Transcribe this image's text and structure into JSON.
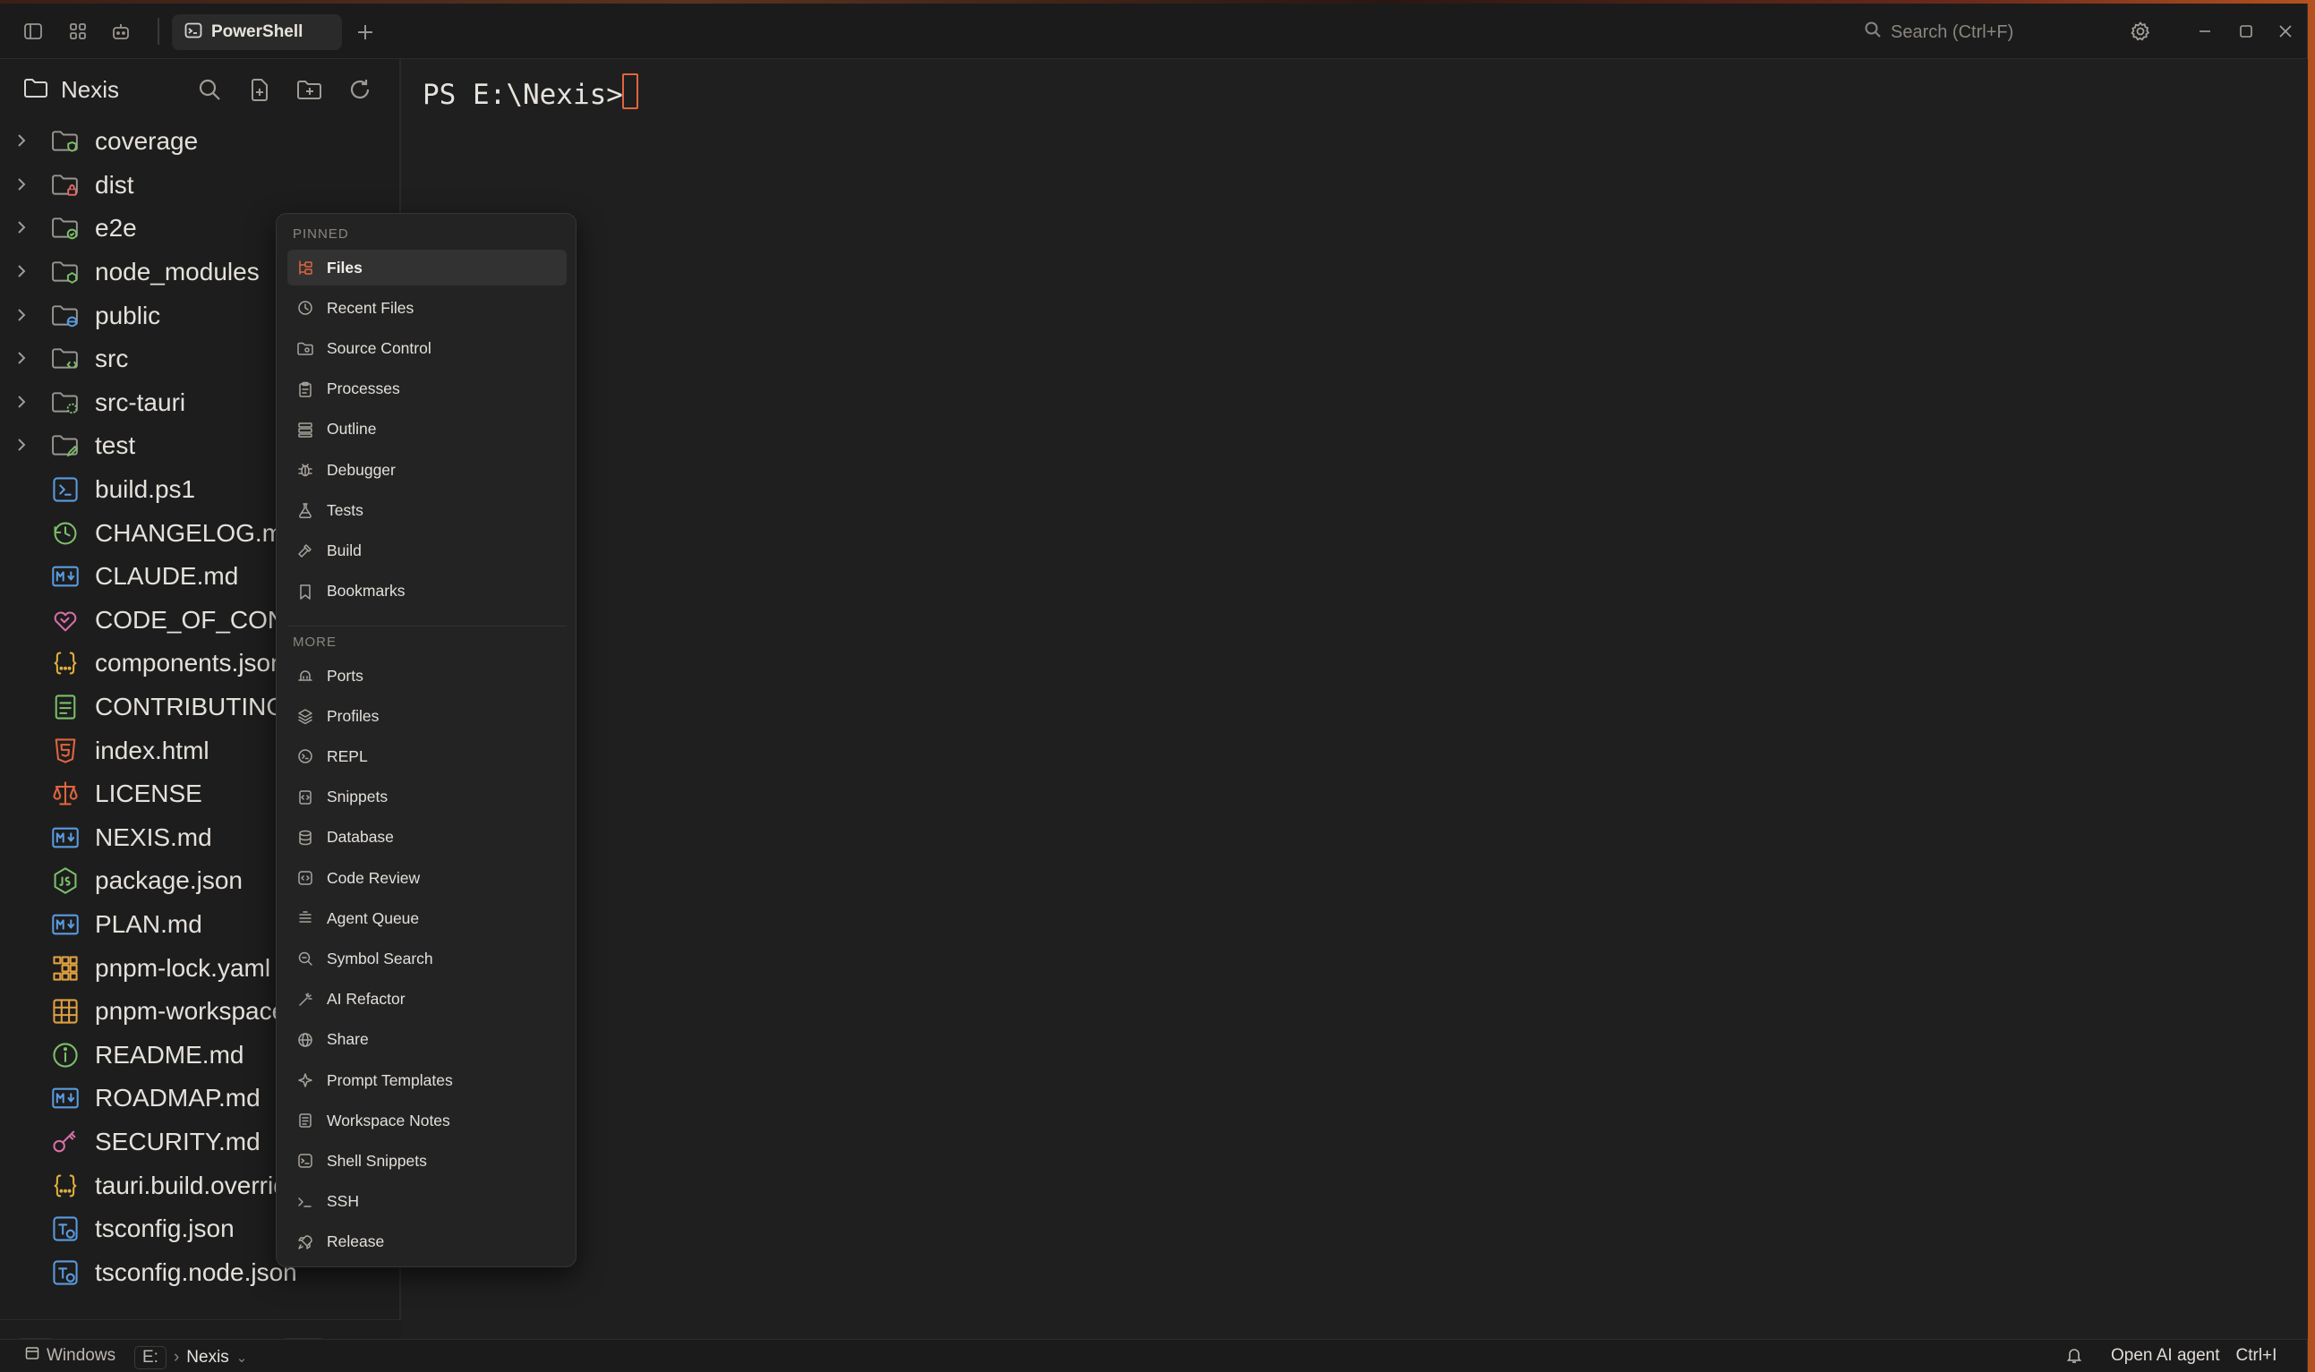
{
  "titlebar": {
    "tab_label": "PowerShell",
    "search_placeholder": "Search (Ctrl+F)"
  },
  "sidebar": {
    "folder_name": "Nexis",
    "items": [
      {
        "label": "coverage",
        "type": "folder",
        "icon": "folder-shield-icon",
        "color": "#7bbf6a"
      },
      {
        "label": "dist",
        "type": "folder",
        "icon": "folder-lock-icon",
        "color": "#e06b6b"
      },
      {
        "label": "e2e",
        "type": "folder",
        "icon": "folder-check-icon",
        "color": "#7bbf6a"
      },
      {
        "label": "node_modules",
        "type": "folder",
        "icon": "folder-node-icon",
        "color": "#7bbf6a"
      },
      {
        "label": "public",
        "type": "folder",
        "icon": "folder-globe-icon",
        "color": "#5a9be0"
      },
      {
        "label": "src",
        "type": "folder",
        "icon": "folder-code-icon",
        "color": "#7bbf6a"
      },
      {
        "label": "src-tauri",
        "type": "folder",
        "icon": "folder-gear-icon",
        "color": "#7bbf6a"
      },
      {
        "label": "test",
        "type": "folder",
        "icon": "folder-pen-icon",
        "color": "#7bbf6a"
      },
      {
        "label": "build.ps1",
        "type": "file",
        "icon": "powershell-file-icon",
        "color": "#5a9be0"
      },
      {
        "label": "CHANGELOG.md",
        "type": "file",
        "icon": "history-file-icon",
        "color": "#7bbf6a"
      },
      {
        "label": "CLAUDE.md",
        "type": "file",
        "icon": "markdown-file-icon",
        "color": "#5a9be0"
      },
      {
        "label": "CODE_OF_CONDUCT.md",
        "type": "file",
        "icon": "heart-handshake-icon",
        "color": "#d86fa8"
      },
      {
        "label": "components.json",
        "type": "file",
        "icon": "json-file-icon",
        "color": "#e0b040"
      },
      {
        "label": "CONTRIBUTING.md",
        "type": "file",
        "icon": "document-file-icon",
        "color": "#7bbf6a"
      },
      {
        "label": "index.html",
        "type": "file",
        "icon": "html-file-icon",
        "color": "#e0653f"
      },
      {
        "label": "LICENSE",
        "type": "file",
        "icon": "scale-icon",
        "color": "#e0653f"
      },
      {
        "label": "NEXIS.md",
        "type": "file",
        "icon": "markdown-file-icon",
        "color": "#5a9be0"
      },
      {
        "label": "package.json",
        "type": "file",
        "icon": "nodejs-file-icon",
        "color": "#7bbf6a"
      },
      {
        "label": "PLAN.md",
        "type": "file",
        "icon": "markdown-file-icon",
        "color": "#5a9be0"
      },
      {
        "label": "pnpm-lock.yaml",
        "type": "file",
        "icon": "pnpm-lock-icon",
        "color": "#e0a040"
      },
      {
        "label": "pnpm-workspace.yaml",
        "type": "file",
        "icon": "pnpm-grid-icon",
        "color": "#e0a040"
      },
      {
        "label": "README.md",
        "type": "file",
        "icon": "info-file-icon",
        "color": "#7bbf6a"
      },
      {
        "label": "ROADMAP.md",
        "type": "file",
        "icon": "markdown-file-icon",
        "color": "#5a9be0"
      },
      {
        "label": "SECURITY.md",
        "type": "file",
        "icon": "key-file-icon",
        "color": "#d86fa8"
      },
      {
        "label": "tauri.build.override.json",
        "type": "file",
        "icon": "json-file-icon",
        "color": "#e0b040"
      },
      {
        "label": "tsconfig.json",
        "type": "file",
        "icon": "typescript-config-icon",
        "color": "#5a9be0"
      },
      {
        "label": "tsconfig.node.json",
        "type": "file",
        "icon": "typescript-config-icon",
        "color": "#5a9be0"
      }
    ]
  },
  "terminal": {
    "prompt": "PS E:\\Nexis> "
  },
  "popup": {
    "pinned_header": "PINNED",
    "more_header": "MORE",
    "pinned": [
      {
        "label": "Files",
        "icon": "tree-icon",
        "selected": true
      },
      {
        "label": "Recent Files",
        "icon": "clock-icon"
      },
      {
        "label": "Source Control",
        "icon": "source-control-icon"
      },
      {
        "label": "Processes",
        "icon": "clipboard-icon"
      },
      {
        "label": "Outline",
        "icon": "outline-icon"
      },
      {
        "label": "Debugger",
        "icon": "bug-icon"
      },
      {
        "label": "Tests",
        "icon": "flask-icon"
      },
      {
        "label": "Build",
        "icon": "hammer-icon"
      },
      {
        "label": "Bookmarks",
        "icon": "bookmark-icon"
      }
    ],
    "more": [
      {
        "label": "Ports",
        "icon": "ports-icon"
      },
      {
        "label": "Profiles",
        "icon": "layers-icon"
      },
      {
        "label": "REPL",
        "icon": "repl-icon"
      },
      {
        "label": "Snippets",
        "icon": "snippet-icon"
      },
      {
        "label": "Database",
        "icon": "database-icon"
      },
      {
        "label": "Code Review",
        "icon": "code-review-icon"
      },
      {
        "label": "Agent Queue",
        "icon": "queue-icon"
      },
      {
        "label": "Symbol Search",
        "icon": "symbol-search-icon"
      },
      {
        "label": "AI Refactor",
        "icon": "wand-icon"
      },
      {
        "label": "Share",
        "icon": "globe-icon"
      },
      {
        "label": "Prompt Templates",
        "icon": "sparkle-icon"
      },
      {
        "label": "Workspace Notes",
        "icon": "note-icon"
      },
      {
        "label": "Shell Snippets",
        "icon": "shell-snippet-icon"
      },
      {
        "label": "SSH",
        "icon": "terminal-prompt-icon"
      },
      {
        "label": "Release",
        "icon": "rocket-icon"
      }
    ]
  },
  "statusbar": {
    "os": "Windows",
    "drive": "E:",
    "folder": "Nexis",
    "ai_agent": "Open AI agent",
    "ai_shortcut": "Ctrl+I"
  },
  "colors": {
    "accent": "#e0653f",
    "background": "#1f1f1f",
    "sidebar": "#1d1d1d"
  }
}
